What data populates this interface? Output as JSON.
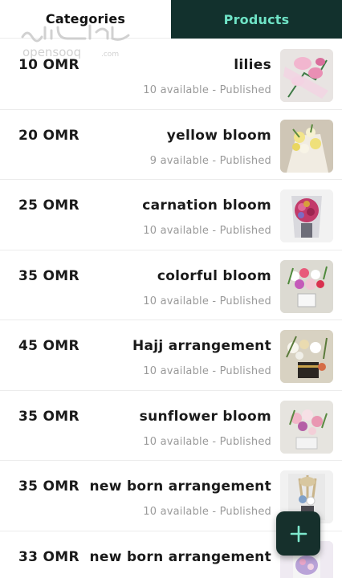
{
  "tabs": {
    "categories": "Categories",
    "products": "Products",
    "active": "products"
  },
  "watermark": {
    "arabic": "السوق المفتوح",
    "latin": "opensooq.com"
  },
  "colors": {
    "tab_active_bg": "#12312d",
    "tab_active_text": "#6fe3c6",
    "fab_bg": "#16302c",
    "status_text": "#9a9a9a"
  },
  "products": [
    {
      "price": "10 OMR",
      "name": "lilies",
      "status": "10 available - Published",
      "image": "lilies-bouquet"
    },
    {
      "price": "20 OMR",
      "name": "yellow bloom",
      "status": "9 available - Published",
      "image": "yellow-bouquet"
    },
    {
      "price": "25 OMR",
      "name": "carnation bloom",
      "status": "10 available - Published",
      "image": "carnation-bouquet"
    },
    {
      "price": "35 OMR",
      "name": "colorful bloom",
      "status": "10 available - Published",
      "image": "colorful-arrangement"
    },
    {
      "price": "45 OMR",
      "name": "Hajj arrangement",
      "status": "10 available - Published",
      "image": "hajj-arrangement"
    },
    {
      "price": "35 OMR",
      "name": "sunflower bloom",
      "status": "10 available - Published",
      "image": "sunflower-arrangement"
    },
    {
      "price": "35 OMR",
      "name": "new born arrangement",
      "status": "10 available - Published",
      "image": "newborn-arrangement"
    },
    {
      "price": "33 OMR",
      "name": "new born arrangement",
      "status": "",
      "image": "newborn-arrangement-2"
    }
  ],
  "fab": {
    "icon": "plus-icon"
  }
}
